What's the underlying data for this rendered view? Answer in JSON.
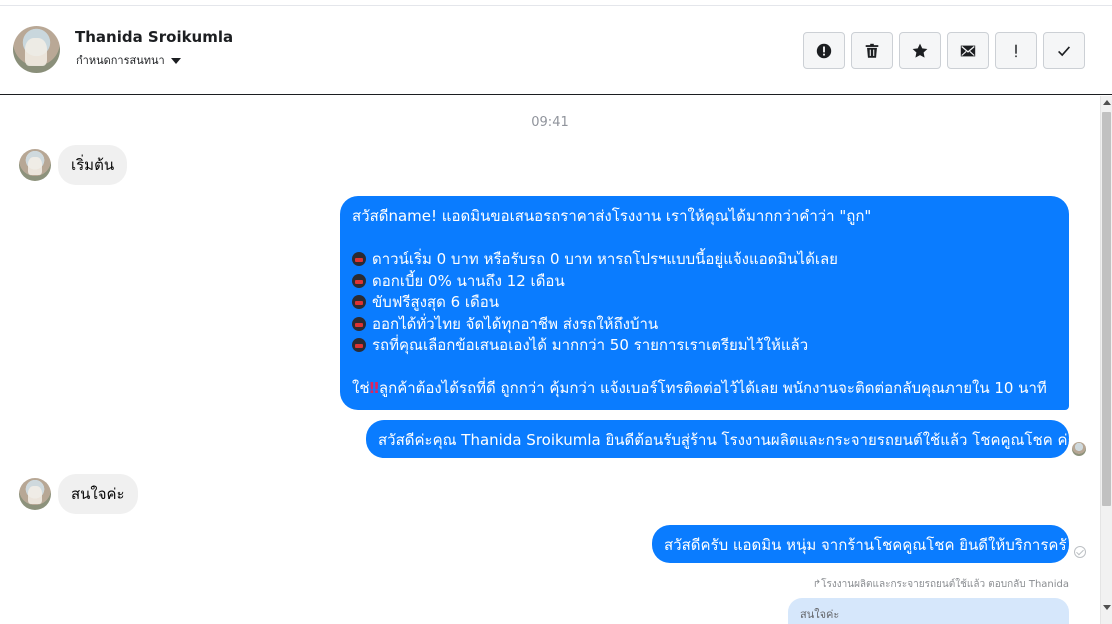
{
  "header": {
    "contact_name": "Thanida Sroikumla",
    "subtitle": "กำหนดการสนทนา",
    "actions": [
      {
        "name": "report-button",
        "icon": "alert-circle-icon"
      },
      {
        "name": "delete-button",
        "icon": "trash-icon"
      },
      {
        "name": "star-button",
        "icon": "star-icon"
      },
      {
        "name": "mark-unread-button",
        "icon": "envelope-icon"
      },
      {
        "name": "mark-important-button",
        "icon": "exclamation-icon"
      },
      {
        "name": "mark-done-button",
        "icon": "check-icon"
      }
    ]
  },
  "thread": {
    "timestamp": "09:41",
    "msg1": "เริ่มต้น",
    "msg2": {
      "line1": "สวัสดีname! แอดมินขอเสนอรถราคาส่งโรงงาน เราให้คุณได้มากกว่าคำว่า \"ถูก\"",
      "bullet1": "ดาวน์เริ่ม 0 บาท หรือรับรถ 0 บาท หารถโปรฯแบบนี้อยู่แจ้งแอดมินได้เลย",
      "bullet2": "ดอกเบี้ย 0% นานถึง 12 เดือน",
      "bullet3": "ขับฟรีสูงสุด 6 เดือน",
      "bullet4": "ออกได้ทั่วไทย จัดได้ทุกอาชีพ ส่งรถให้ถึงบ้าน",
      "bullet5": "รถที่คุณเลือกข้อเสนอเองได้ มากกว่า 50 รายการเราเตรียมไว้ให้แล้ว",
      "last_prefix": "ใช่",
      "last_mark": "‼",
      "last_rest": "ลูกค้าต้องได้รถที่ดี ถูกกว่า คุ้มกว่า แจ้งเบอร์โทรติดต่อไว้ได้เลย พนักงานจะติดต่อกลับคุณภายใน 10 นาที"
    },
    "msg3": "สวัสดีค่ะคุณ Thanida Sroikumla ยินดีต้อนรับสู่ร้าน โรงงานผลิตและกระจายรถยนต์ใช้แล้ว โชคคูณโชค ค่ะ",
    "msg4": "สนใจค่ะ",
    "msg5": "สวัสดีครับ แอดมิน หนุ่ม จากร้านโชคคูณโชค ยินดีให้บริการครั",
    "reply_meta": "โรงงานผลิตและกระจายรถยนต์ใช้แล้ว ตอบกลับ Thanida",
    "reply_preview": "สนใจค่ะ"
  },
  "colors": {
    "outgoing_bubble": "#0a7cff",
    "incoming_bubble": "#f0f0f0",
    "reply_preview": "#d6e7fb"
  }
}
